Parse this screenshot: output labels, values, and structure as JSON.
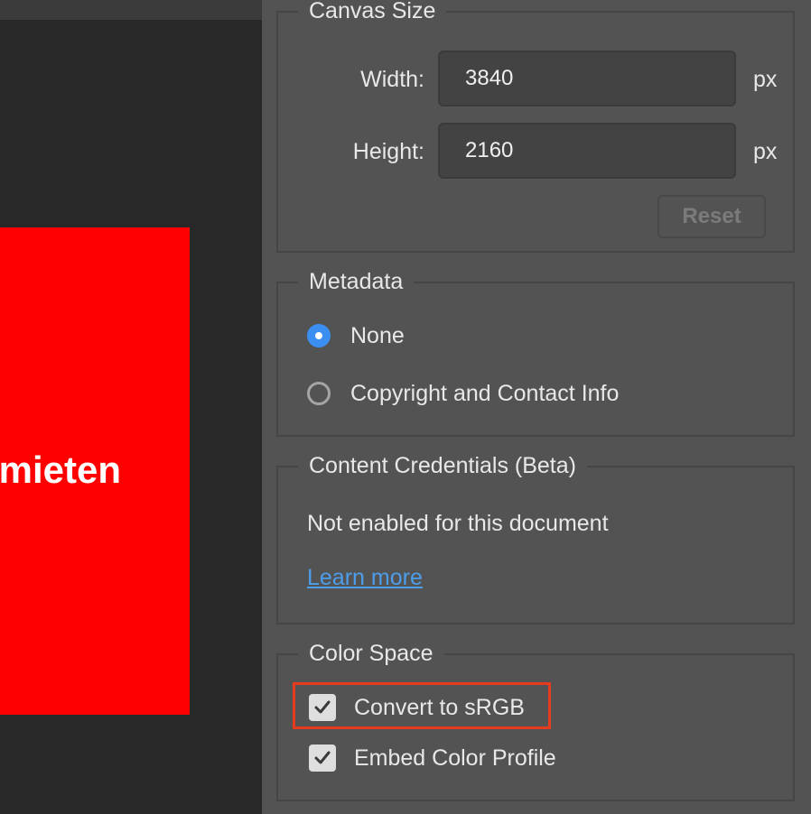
{
  "preview": {
    "image_text": "mieten",
    "image_color": "#ff0000"
  },
  "canvas_size": {
    "title": "Canvas Size",
    "width_label": "Width:",
    "width_value": "3840",
    "width_unit": "px",
    "height_label": "Height:",
    "height_value": "2160",
    "height_unit": "px",
    "reset_label": "Reset"
  },
  "metadata": {
    "title": "Metadata",
    "options": [
      {
        "label": "None",
        "selected": true
      },
      {
        "label": "Copyright and Contact Info",
        "selected": false
      }
    ]
  },
  "content_credentials": {
    "title": "Content Credentials (Beta)",
    "status": "Not enabled for this document",
    "link": "Learn more"
  },
  "color_space": {
    "title": "Color Space",
    "options": [
      {
        "label": "Convert to sRGB",
        "checked": true
      },
      {
        "label": "Embed Color Profile",
        "checked": true
      }
    ]
  },
  "colors": {
    "accent": "#3b8ff1",
    "link": "#4d9eea",
    "highlight": "#e63b1f",
    "panel_bg": "#535353"
  },
  "icons": {
    "radio_selected": "radio-selected-icon",
    "radio_unselected": "radio-unselected-icon",
    "checkbox_checked": "checkmark-icon"
  }
}
